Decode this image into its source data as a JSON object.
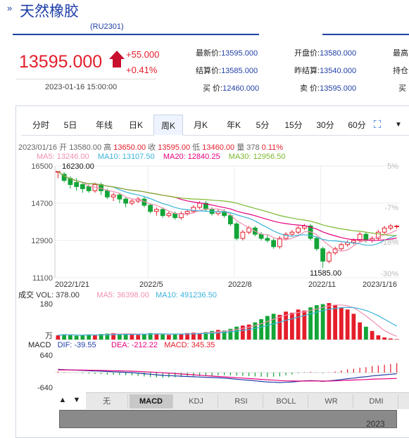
{
  "header": {
    "title": "天然橡胶",
    "code": "(RU2301)",
    "price": "13595.000",
    "change": "+55.000",
    "change_pct": "+0.41%",
    "timestamp": "2023-01-16 15:00:00",
    "quotes": [
      {
        "label": "最新价:",
        "value": "13595.000"
      },
      {
        "label": "开盘价:",
        "value": "13580.000"
      },
      {
        "label": "最高",
        "value": ""
      },
      {
        "label": "结算价:",
        "value": "13585.000"
      },
      {
        "label": "昨结算:",
        "value": "13540.000"
      },
      {
        "label": "持仓",
        "value": ""
      },
      {
        "label": "买  价:",
        "value": "12460.000"
      },
      {
        "label": "卖  价:",
        "value": "13595.000"
      },
      {
        "label": "买",
        "value": ""
      }
    ]
  },
  "tabs": [
    "分时",
    "5日",
    "年线",
    "日K",
    "周K",
    "月K",
    "年K",
    "5分",
    "15分",
    "30分",
    "60分"
  ],
  "active_tab": "周K",
  "info_line": {
    "date": "2023/01/16",
    "open_label": "开",
    "open": "13580.00",
    "high_label": "高",
    "high": "13650.00",
    "close_label": "收",
    "close": "13595.00",
    "low_label": "低",
    "low": "13460.00",
    "vol_label": "量",
    "vol": "378",
    "pct": "0.11%"
  },
  "ma_line": {
    "ma5": "MA5: 13246.00",
    "ma10": "MA10: 13107.50",
    "ma20": "MA20: 12840.25",
    "ma30": "MA30: 12956.50"
  },
  "vol_line": {
    "label": "成交",
    "vol": "VOL: 378.00",
    "ma5": "MA5: 36398.00",
    "ma10": "MA10: 491236.50"
  },
  "macd_line": {
    "label": "MACD",
    "dif": "DIF: -39.55",
    "dea": "DEA: -212.22",
    "macd": "MACD: 345.35"
  },
  "indicators": [
    "无",
    "MACD",
    "KDJ",
    "RSI",
    "BOLL",
    "WR",
    "DMI"
  ],
  "active_indicator": "MACD",
  "range_year": "2023",
  "colors": {
    "up": "#e41e2b",
    "down": "#13a538",
    "ma5": "#f08fb0",
    "ma10": "#3ab3d9",
    "ma20": "#e6007e",
    "ma30": "#7cb82f",
    "brand": "#1f3fa6"
  },
  "chart_data": {
    "type": "candlestick",
    "price_axis": {
      "ticks": [
        "16500",
        "14700",
        "12900",
        "11100"
      ],
      "range": [
        11100,
        16500
      ]
    },
    "pct_axis": {
      "ticks": [
        "5%",
        "-7%",
        "-18%",
        "-30%"
      ]
    },
    "x_labels": [
      "2022/1/21",
      "2022/5",
      "2022/8",
      "2022/11",
      "2023/1/16"
    ],
    "annotations": {
      "high": "16230.00",
      "low": "11585.00"
    },
    "volume_axis": {
      "top": "180",
      "unit": "万"
    },
    "macd_axis": {
      "top": "640",
      "bottom": "-640"
    },
    "candles": [
      [
        16200,
        16250,
        15900,
        16230
      ],
      [
        16100,
        16200,
        15700,
        15800
      ],
      [
        15900,
        16000,
        15400,
        15600
      ],
      [
        15700,
        15900,
        15300,
        15500
      ],
      [
        15600,
        15700,
        15200,
        15400
      ],
      [
        15500,
        15600,
        15200,
        15300
      ],
      [
        15300,
        15700,
        15200,
        15600
      ],
      [
        15600,
        15700,
        15100,
        15300
      ],
      [
        15300,
        15400,
        14900,
        15000
      ],
      [
        15000,
        15200,
        14800,
        15100
      ],
      [
        15100,
        15200,
        14700,
        14900
      ],
      [
        14900,
        15000,
        14500,
        14700
      ],
      [
        14700,
        14900,
        14600,
        14800
      ],
      [
        14800,
        15000,
        14700,
        14900
      ],
      [
        14900,
        15000,
        14500,
        14600
      ],
      [
        14600,
        14700,
        14200,
        14300
      ],
      [
        14300,
        14500,
        14100,
        14400
      ],
      [
        14400,
        14500,
        14000,
        14100
      ],
      [
        14100,
        14300,
        14000,
        14200
      ],
      [
        14200,
        14300,
        13900,
        14000
      ],
      [
        14000,
        14300,
        13900,
        14200
      ],
      [
        14200,
        14400,
        14100,
        14300
      ],
      [
        14300,
        14600,
        14200,
        14500
      ],
      [
        14500,
        14800,
        14400,
        14700
      ],
      [
        14700,
        14800,
        14300,
        14400
      ],
      [
        14400,
        14500,
        14100,
        14200
      ],
      [
        14200,
        14400,
        14100,
        14300
      ],
      [
        14300,
        14400,
        14000,
        14100
      ],
      [
        14100,
        14200,
        13600,
        13700
      ],
      [
        13700,
        13800,
        12900,
        13000
      ],
      [
        13000,
        13400,
        12900,
        13300
      ],
      [
        13300,
        13600,
        13200,
        13500
      ],
      [
        13500,
        13600,
        13100,
        13200
      ],
      [
        13200,
        13300,
        12900,
        13000
      ],
      [
        13000,
        13200,
        12800,
        12900
      ],
      [
        12900,
        13000,
        12500,
        12600
      ],
      [
        12600,
        13100,
        12500,
        13000
      ],
      [
        13000,
        13300,
        12900,
        13200
      ],
      [
        13200,
        13400,
        13100,
        13300
      ],
      [
        13300,
        13600,
        13200,
        13500
      ],
      [
        13500,
        13700,
        13400,
        13600
      ],
      [
        13600,
        13700,
        12900,
        13000
      ],
      [
        13000,
        13100,
        12400,
        12500
      ],
      [
        12500,
        12600,
        11585,
        11900
      ],
      [
        11900,
        12400,
        11800,
        12300
      ],
      [
        12300,
        12600,
        12200,
        12500
      ],
      [
        12500,
        12800,
        12400,
        12700
      ],
      [
        12700,
        12900,
        12600,
        12800
      ],
      [
        12800,
        13000,
        12700,
        12900
      ],
      [
        12900,
        13300,
        12800,
        13200
      ],
      [
        13200,
        13300,
        12800,
        12900
      ],
      [
        12900,
        13100,
        12800,
        13000
      ],
      [
        13000,
        13400,
        12900,
        13300
      ],
      [
        13300,
        13600,
        13200,
        13500
      ],
      [
        13500,
        13700,
        13400,
        13600
      ],
      [
        13580,
        13650,
        13460,
        13595
      ]
    ],
    "volume": [
      20,
      25,
      22,
      18,
      20,
      24,
      21,
      26,
      28,
      30,
      25,
      27,
      24,
      22,
      26,
      30,
      28,
      24,
      22,
      26,
      28,
      30,
      32,
      30,
      35,
      40,
      45,
      42,
      50,
      60,
      65,
      70,
      80,
      95,
      110,
      120,
      115,
      130,
      125,
      140,
      135,
      150,
      160,
      165,
      170,
      160,
      150,
      140,
      120,
      80,
      60,
      40,
      20,
      10,
      5,
      2
    ],
    "dif": [
      120,
      110,
      100,
      90,
      80,
      70,
      60,
      55,
      40,
      30,
      20,
      10,
      0,
      -20,
      -40,
      -60,
      -80,
      -100,
      -110,
      -120,
      -130,
      -140,
      -150,
      -160,
      -170,
      -180,
      -190,
      -200,
      -220,
      -240,
      -260,
      -280,
      -300,
      -320,
      -340,
      -350,
      -360,
      -350,
      -340,
      -320,
      -300,
      -290,
      -300,
      -320,
      -300,
      -280,
      -250,
      -220,
      -200,
      -170,
      -150,
      -120,
      -100,
      -80,
      -60,
      -40
    ],
    "dea": [
      100,
      100,
      98,
      95,
      92,
      88,
      84,
      80,
      75,
      70,
      64,
      58,
      50,
      40,
      30,
      20,
      8,
      -5,
      -20,
      -35,
      -50,
      -65,
      -80,
      -95,
      -110,
      -125,
      -140,
      -155,
      -170,
      -185,
      -200,
      -215,
      -230,
      -245,
      -260,
      -275,
      -290,
      -300,
      -305,
      -308,
      -308,
      -305,
      -305,
      -308,
      -306,
      -300,
      -290,
      -280,
      -270,
      -260,
      -250,
      -240,
      -230,
      -225,
      -218,
      -212
    ]
  }
}
